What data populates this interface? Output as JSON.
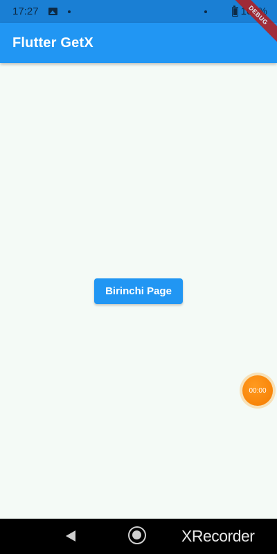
{
  "status_bar": {
    "time": "17:27",
    "battery": "100%",
    "icons": [
      "image-icon",
      "dot-icon",
      "dot-icon",
      "battery-icon"
    ]
  },
  "app_bar": {
    "title": "Flutter GetX",
    "color": "#2196f3"
  },
  "debug_banner": {
    "label": "DEBUG"
  },
  "main": {
    "button_label": "Birinchi Page",
    "background": "#f4faf6"
  },
  "recorder": {
    "timer": "00:00",
    "watermark": "XRecorder",
    "color": "#f57c00"
  },
  "nav_bar": {
    "icons": [
      "back-icon",
      "home-icon"
    ]
  }
}
